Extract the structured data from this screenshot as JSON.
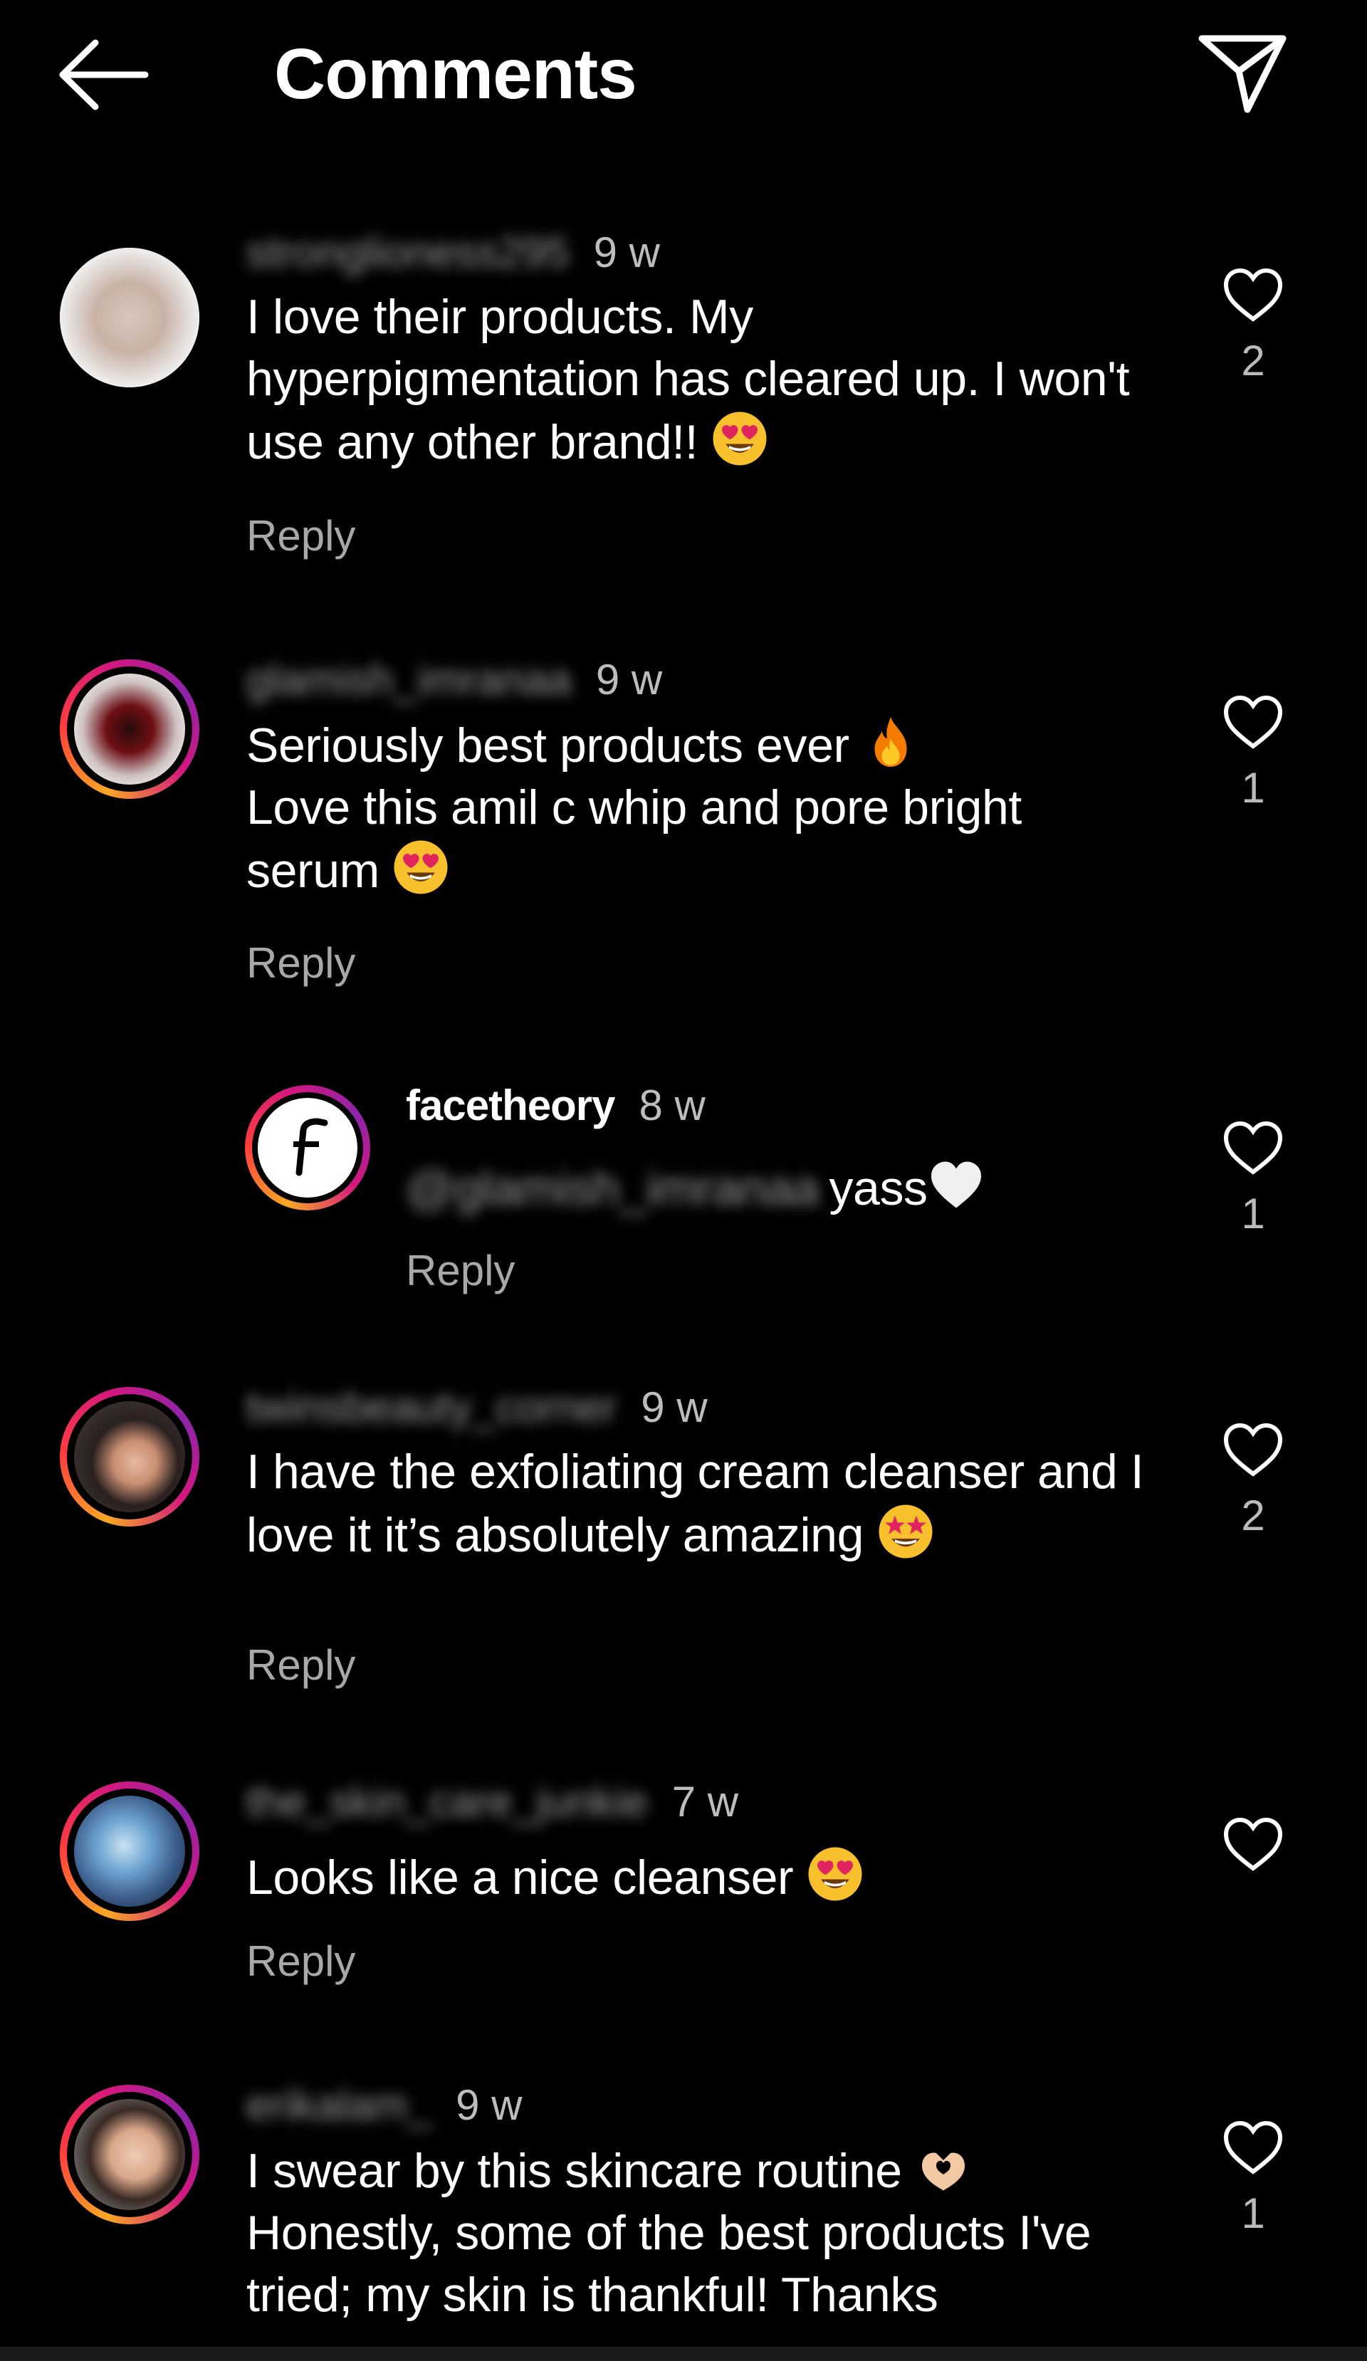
{
  "header": {
    "title": "Comments",
    "back_icon": "arrow-left-icon",
    "send_icon": "paper-plane-icon"
  },
  "colors": {
    "background": "#000000",
    "text": "#ffffff",
    "muted": "#a8a8a8",
    "story_ring": [
      "#f9a825",
      "#ff3d3d",
      "#d3177f",
      "#8e24aa"
    ]
  },
  "comments": [
    {
      "username": "stronglioness295",
      "time": "9 w",
      "text": "I love their products. My hyperpigmentation has cleared up. I won't use any other brand!!",
      "emoji": "heart-eyes-emoji",
      "reply_label": "Reply",
      "likes": "2"
    },
    {
      "username": "glamish_imranaa",
      "time": "9 w",
      "text_line1": "Seriously best products ever",
      "emoji1": "fire-emoji",
      "text_line2": "Love this amil c whip and pore bright serum",
      "emoji2": "heart-eyes-emoji",
      "reply_label": "Reply",
      "likes": "1",
      "reply": {
        "username": "facetheory",
        "time": "8 w",
        "mention": "@glamish_imranaa",
        "text": "yass",
        "emoji": "white-heart-emoji",
        "reply_label": "Reply",
        "likes": "1"
      }
    },
    {
      "username": "twinsbeauty_corner",
      "time": "9 w",
      "text": "I have the exfoliating cream cleanser and I love it it’s absolutely amazing",
      "emoji": "star-struck-emoji",
      "reply_label": "Reply",
      "likes": "2"
    },
    {
      "username": "the_skin_care_junkie",
      "time": "7 w",
      "text": "Looks like a nice cleanser",
      "emoji": "heart-eyes-emoji",
      "reply_label": "Reply",
      "likes": ""
    },
    {
      "username": "erikalam_",
      "time": "9 w",
      "text_line1": "I swear by this skincare routine",
      "emoji1": "heart-hands-emoji",
      "text_line2": "Honestly, some of the best products I've tried; my skin is thankful! Thanks",
      "likes": "1"
    }
  ]
}
